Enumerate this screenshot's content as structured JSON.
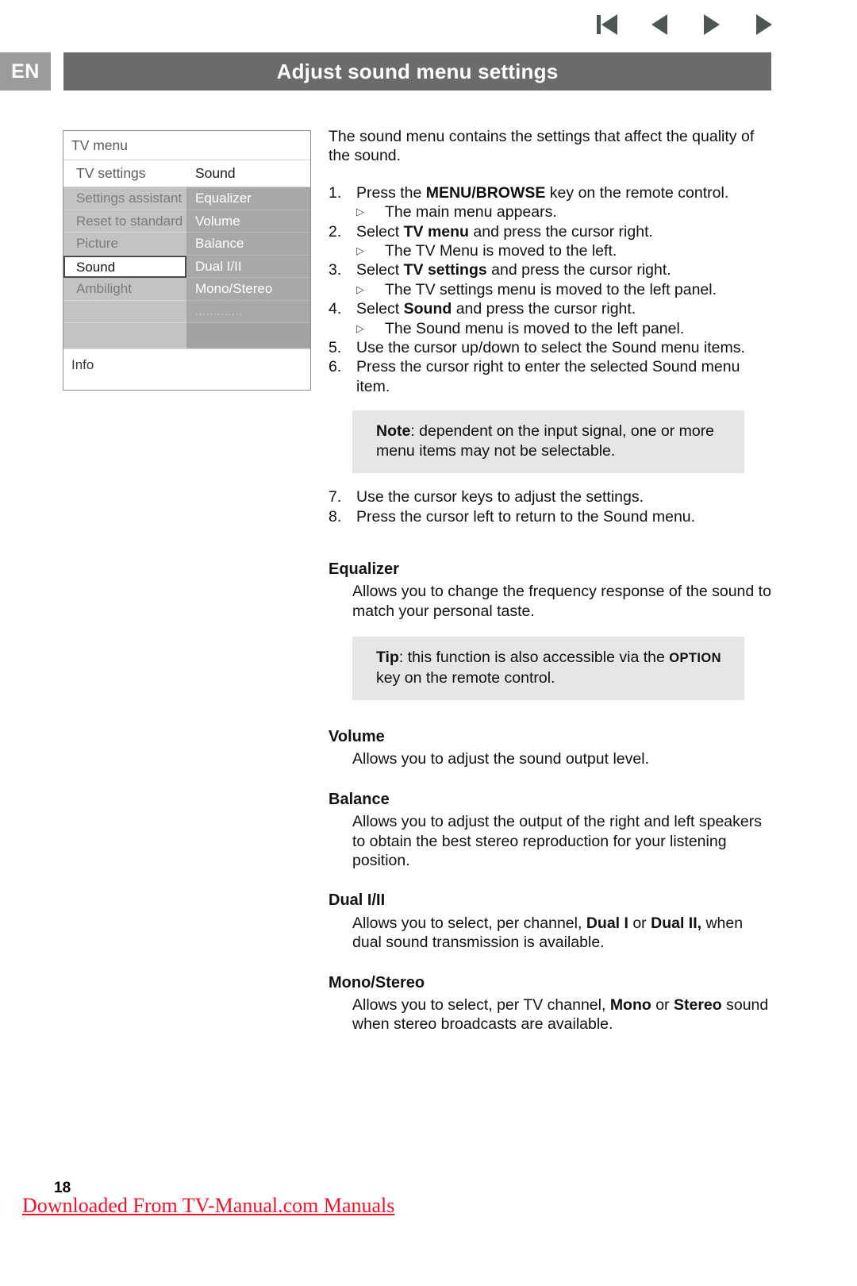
{
  "nav": {
    "buttons": [
      {
        "name": "skip-to-start",
        "icon": "skip-start-icon"
      },
      {
        "name": "previous",
        "icon": "triangle-left-icon"
      },
      {
        "name": "next",
        "icon": "triangle-right-icon"
      },
      {
        "name": "last",
        "icon": "triangle-right-icon"
      }
    ]
  },
  "header": {
    "language": "EN",
    "title": "Adjust sound menu settings",
    "bar_color": "#6b6b6b",
    "badge_color": "#9b9b9b"
  },
  "tv_menu": {
    "title": "TV menu",
    "subhead_left": "TV settings",
    "subhead_right": "Sound",
    "left_items": [
      {
        "label": "Settings assistant",
        "selected": false
      },
      {
        "label": "Reset to standard",
        "selected": false
      },
      {
        "label": "Picture",
        "selected": false
      },
      {
        "label": "Sound",
        "selected": true
      },
      {
        "label": "Ambilight",
        "selected": false
      },
      {
        "label": "",
        "selected": false
      },
      {
        "label": "",
        "selected": false
      }
    ],
    "right_items": [
      {
        "label": "Equalizer"
      },
      {
        "label": "Volume"
      },
      {
        "label": "Balance"
      },
      {
        "label": "Dual I/II"
      },
      {
        "label": "Mono/Stereo"
      },
      {
        "label": "............."
      },
      {
        "label": ""
      }
    ],
    "footer": "Info"
  },
  "content": {
    "intro": "The sound menu contains the settings that affect the quality of the sound.",
    "steps": [
      {
        "num": "1.",
        "text_before": "Press the ",
        "bold": "MENU/BROWSE",
        "text_after": " key on the remote control.",
        "sub": "The main menu appears."
      },
      {
        "num": "2.",
        "text_before": "Select ",
        "bold": "TV menu",
        "text_after": " and press the cursor right.",
        "sub": "The TV Menu is moved to the left."
      },
      {
        "num": "3.",
        "text_before": "Select ",
        "bold": "TV settings",
        "text_after": " and press the cursor right.",
        "sub": "The TV settings menu is moved to the left panel."
      },
      {
        "num": "4.",
        "text_before": "Select ",
        "bold": "Sound",
        "text_after": " and press the cursor right.",
        "sub": "The Sound menu is moved to the left panel."
      },
      {
        "num": "5.",
        "text_before": "Use the cursor up/down to select the Sound menu items.",
        "bold": "",
        "text_after": "",
        "sub": ""
      },
      {
        "num": "6.",
        "text_before": "Press the cursor right to enter the selected Sound menu item.",
        "bold": "",
        "text_after": "",
        "sub": ""
      }
    ],
    "note": {
      "label": "Note",
      "text": ": dependent on the input signal, one or more menu items may not be selectable."
    },
    "steps_after": [
      {
        "num": "7.",
        "text": "Use the cursor keys to adjust the settings."
      },
      {
        "num": "8.",
        "text": "Press the cursor left to return to the Sound menu."
      }
    ],
    "sections": [
      {
        "heading": "Equalizer",
        "body": "Allows you to change the frequency response of the sound to match your personal taste."
      },
      {
        "heading": "Volume",
        "body": "Allows you to adjust the sound output level."
      },
      {
        "heading": "Balance",
        "body": "Allows you to adjust the output of the right and left speakers to obtain the best stereo reproduction for your listening position."
      },
      {
        "heading": "Dual I/II",
        "body_1": "Allows you to select, per channel, ",
        "bold_1": "Dual I",
        "body_2": " or ",
        "bold_2": "Dual II,",
        "body_3": " when dual sound transmission is available."
      },
      {
        "heading": "Mono/Stereo",
        "body_1": "Allows you to select, per TV channel, ",
        "bold_1": "Mono",
        "body_2": " or ",
        "bold_2": "Stereo",
        "body_3": " sound when stereo broadcasts are available."
      }
    ],
    "tip": {
      "label": "Tip",
      "text_before": ": this function is also accessible via the ",
      "smallcaps": "OPTION",
      "text_after": " key on the remote control."
    }
  },
  "footer": {
    "page_number": "18",
    "watermark": "Downloaded From TV-Manual.com Manuals",
    "watermark_color": "#f4122a"
  }
}
